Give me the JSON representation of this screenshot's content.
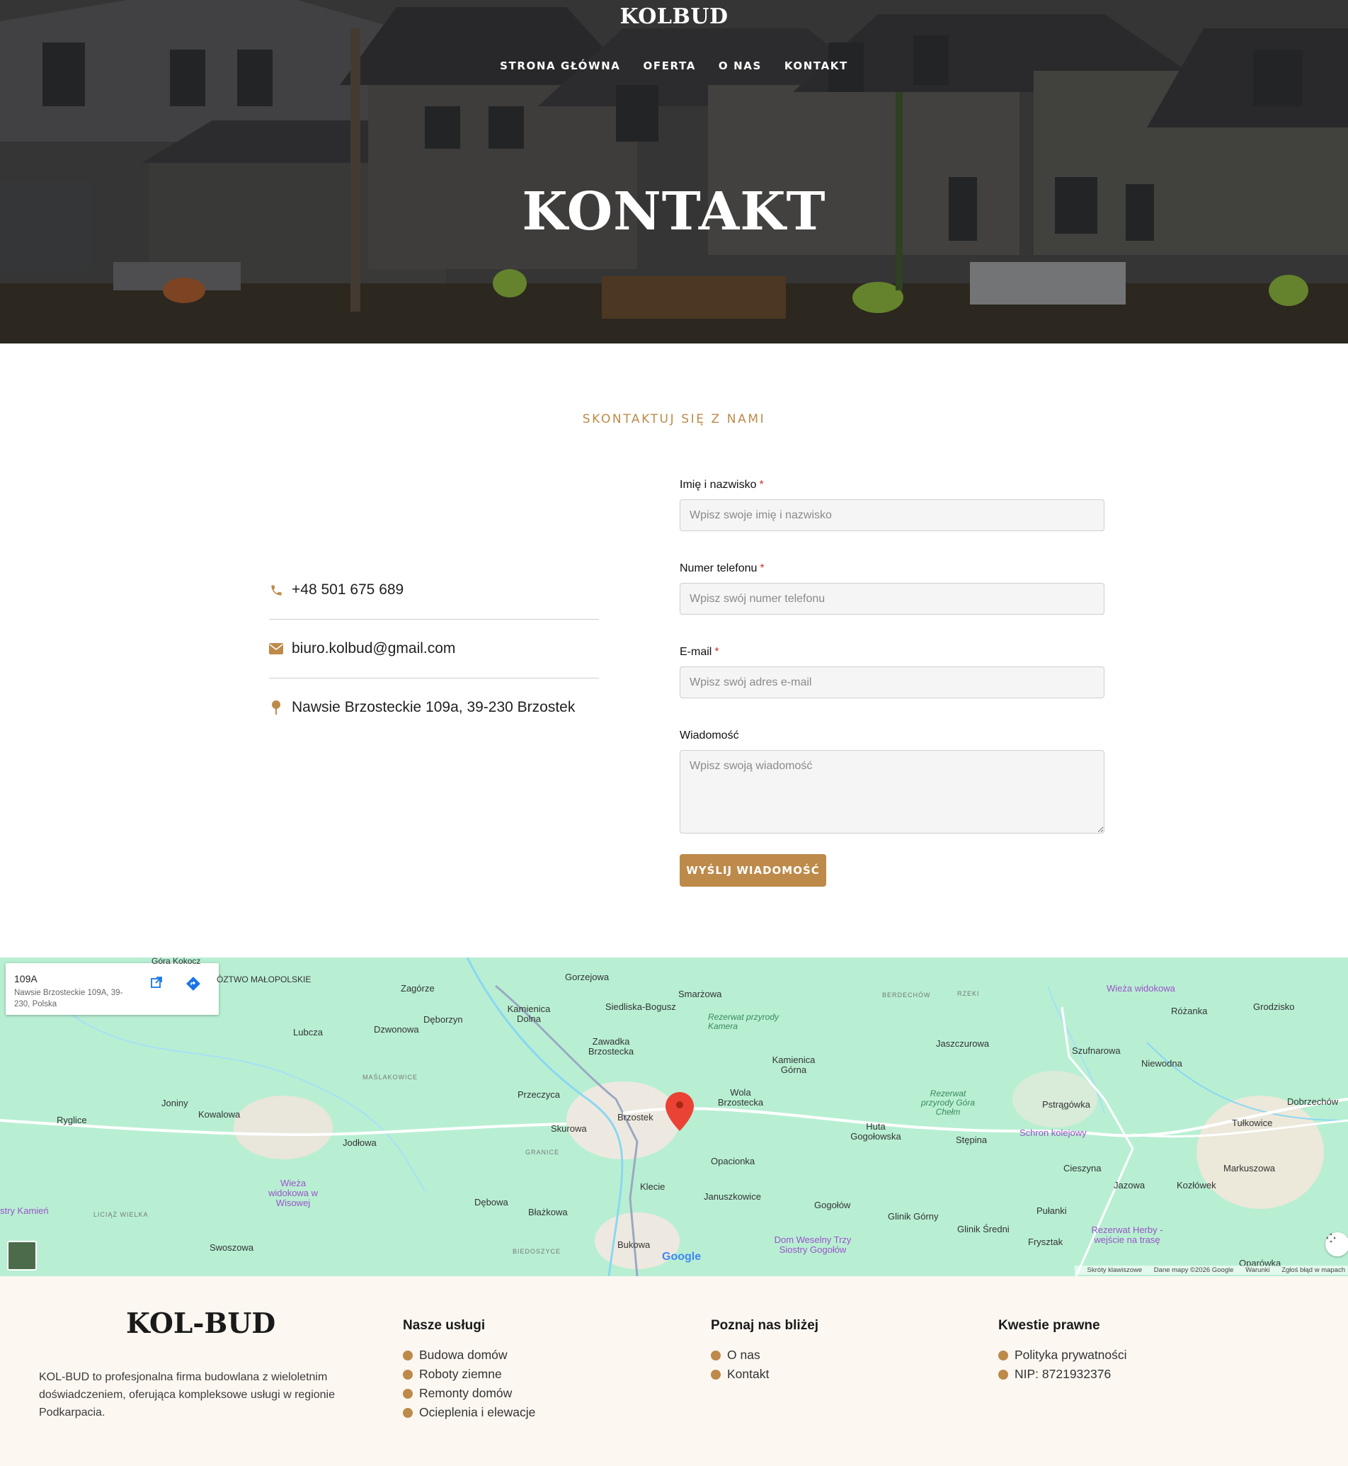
{
  "brand": "KOLBUD",
  "nav": [
    {
      "label": "STRONA GŁÓWNA"
    },
    {
      "label": "OFERTA"
    },
    {
      "label": "O NAS"
    },
    {
      "label": "KONTAKT"
    }
  ],
  "hero": {
    "title": "KONTAKT"
  },
  "contact": {
    "eyebrow": "SKONTAKTUJ SIĘ Z NAMI",
    "phone": "+48 501 675 689",
    "email": "biuro.kolbud@gmail.com",
    "address": "Nawsie Brzosteckie 109a, 39-230 Brzostek"
  },
  "form": {
    "name": {
      "label": "Imię i nazwisko",
      "required": "*",
      "placeholder": "Wpisz swoje imię i nazwisko"
    },
    "phone": {
      "label": "Numer telefonu",
      "required": "*",
      "placeholder": "Wpisz swój numer telefonu"
    },
    "email": {
      "label": "E-mail",
      "required": "*",
      "placeholder": "Wpisz swój adres e-mail"
    },
    "message": {
      "label": "Wiadomość",
      "placeholder": "Wpisz swoją wiadomość"
    },
    "submit": "WYŚLIJ WIADOMOŚĆ"
  },
  "map": {
    "card_title": "109A",
    "card_address": "Nawsie Brzosteckie 109A, 39-230, Polska",
    "google": "Google",
    "attribution": {
      "shortcuts": "Skróty klawiszowe",
      "data": "Dane mapy ©2026 Google",
      "terms": "Warunki",
      "report": "Zgłoś błąd w mapach"
    },
    "labels": {
      "gorzejowa": "Gorzejowa",
      "zagorze": "Zagórze",
      "smarzowa": "Smarżowa",
      "siedliska": "Siedliska-Bogusz",
      "kamienica_dolna": "Kamienica Dolna",
      "deborzyn": "Dęborzyn",
      "dzwonowa": "Dzwonowa",
      "lubcza": "Lubcza",
      "malopolskie": "ÓZTWO MAŁOPOLSKIE",
      "rezerwat_kamera": "Rezerwat przyrody Kamera",
      "zawadka": "Zawadka Brzostecka",
      "kamienica_gorna": "Kamienica Górna",
      "jaszczurowa": "Jaszczurowa",
      "szufnarowa": "Szufnarowa",
      "niewodna": "Niewodna",
      "wieza_top": "Wieża widokowa",
      "rozanka": "Różanka",
      "grodzisko": "Grodzisko",
      "berdechow": "BERDECHÓW",
      "rzeki": "RZEKI",
      "maslakowice": "MAŚLAKOWICE",
      "przeczyca": "Przeczyca",
      "brzostek": "Brzostek",
      "wola": "Wola Brzostecka",
      "joniny": "Joniny",
      "kowalowa": "Kowalowa",
      "ryglice": "Ryglice",
      "skurowa": "Skurowa",
      "granice": "GRANICE",
      "jodlowa": "Jodłowa",
      "rezerwat_chelm": "Rezerwat przyrody Góra Chełm",
      "huta": "Huta Gogołowska",
      "stepina": "Stępina",
      "schron": "Schron kolejowy",
      "pstragowka": "Pstrągówka",
      "tulkowice": "Tułkowice",
      "dobrzechow": "Dobrzechów",
      "opacionka": "Opacionka",
      "cieszyna": "Cieszyna",
      "jazowa": "Jazowa",
      "kozlowek": "Kozłówek",
      "markuszowa": "Markuszowa",
      "wieza_wisowa": "Wieża widokowa w Wisowej",
      "klecie": "Klecie",
      "januszkowice": "Januszkowice",
      "gogolow": "Gogołów",
      "glinik_gorny": "Glinik Górny",
      "glinik_sredni": "Glinik Średni",
      "pulanki": "Pułanki",
      "frysztak": "Frysztak",
      "rezerwat_herby": "Rezerwat Herby - wejście na trasę",
      "dom_weselny": "Dom Weselny Trzy Siostry Gogołów",
      "debowa": "Dębowa",
      "blazkowa": "Błażkowa",
      "bukowa": "Bukowa",
      "swoszowa": "Swoszowa",
      "liciaz": "LICIĄŻ WIELKA",
      "biedoszyce": "BIEDOSZYCE",
      "kamien": "stry Kamień",
      "gora_kokocz": "Góra Kokocz",
      "oparowka": "Oparówka"
    }
  },
  "footer": {
    "brand": "KOL-BUD",
    "description": "KOL-BUD to profesjonalna firma budowlana z wieloletnim doświadczeniem, oferująca kompleksowe usługi w regionie Podkarpacia.",
    "services": {
      "title": "Nasze usługi",
      "items": [
        "Budowa domów",
        "Roboty ziemne",
        "Remonty domów",
        "Ocieplenia i elewacje"
      ]
    },
    "about": {
      "title": "Poznaj nas bliżej",
      "items": [
        "O nas",
        "Kontakt"
      ]
    },
    "legal": {
      "title": "Kwestie prawne",
      "items": [
        "Polityka prywatności",
        "NIP: 8721932376"
      ]
    }
  },
  "colors": {
    "accent": "#bd8a4a",
    "required": "#d2322d",
    "footer_bg": "#fcf7f1",
    "map_bg": "#b8efd3"
  }
}
